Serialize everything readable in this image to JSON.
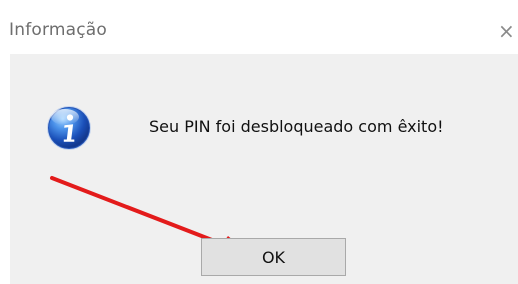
{
  "window": {
    "title": "Informação",
    "close_icon": "close-icon"
  },
  "dialog": {
    "icon": "info-icon",
    "message": "Seu PIN foi desbloqueado com êxito!",
    "ok_label": "OK"
  },
  "annotation": {
    "arrow_color": "#e31b1b"
  },
  "colors": {
    "dialog_background": "#f0f0f0",
    "title_text": "#6e6e6e",
    "button_background": "#e1e1e1",
    "accent": "#0a6fd6"
  }
}
